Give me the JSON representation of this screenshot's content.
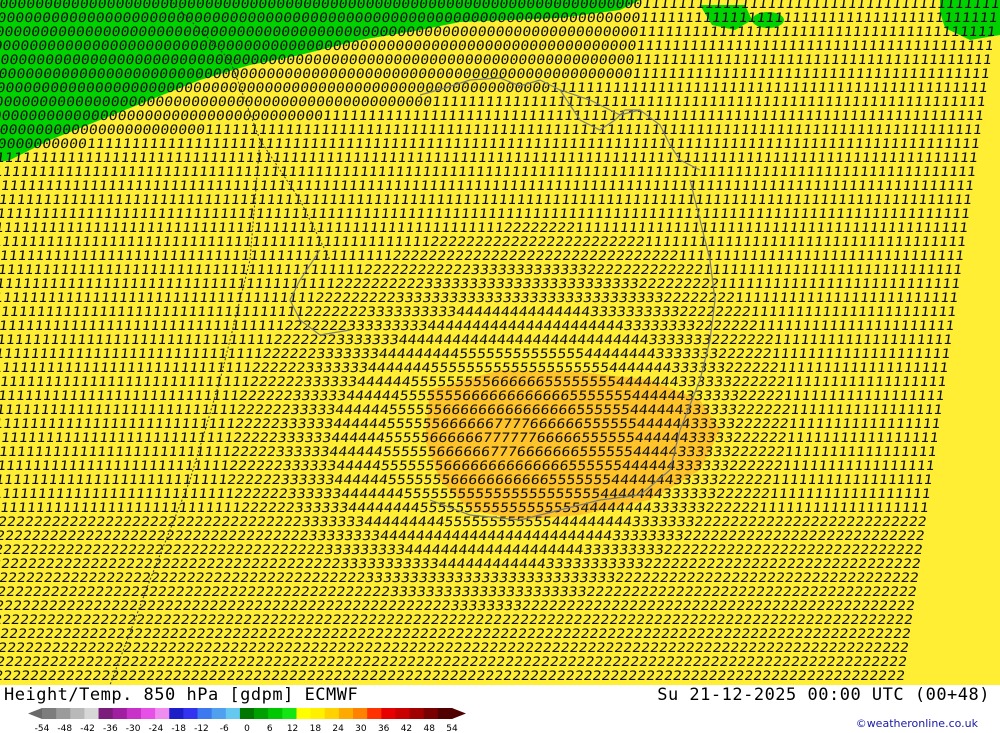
{
  "footer": {
    "title_left": "Height/Temp. 850 hPa [gdpm] ECMWF",
    "title_right": "Su 21-12-2025 00:00 UTC (00+48)",
    "credit": "©weatheronline.co.uk"
  },
  "legend": {
    "ticks": [
      "-54",
      "-48",
      "-42",
      "-36",
      "-30",
      "-24",
      "-18",
      "-12",
      "-6",
      "0",
      "6",
      "12",
      "18",
      "24",
      "30",
      "36",
      "42",
      "48",
      "54"
    ],
    "colors": [
      "#7d7d7d",
      "#9b9b9b",
      "#b9b9b9",
      "#d7d7d7",
      "#7b1d7b",
      "#a01fa0",
      "#c832c8",
      "#e650e6",
      "#f08cf0",
      "#1e1ec8",
      "#3232f0",
      "#3c78f0",
      "#50a0f0",
      "#64c8f0",
      "#007800",
      "#00a000",
      "#00c800",
      "#14e614",
      "#ffff00",
      "#fff000",
      "#ffd200",
      "#ffaa00",
      "#ff8200",
      "#ff3200",
      "#e60000",
      "#c80000",
      "#a00000",
      "#780000",
      "#500000"
    ]
  },
  "map_colors": {
    "green": "#00d200",
    "yellow": "#ffee33",
    "orange": "#ffc42a",
    "digits": "#111111",
    "coast": "#7a7a7a"
  },
  "fields": {
    "zero_one_band": "0",
    "warm_core": "7"
  }
}
